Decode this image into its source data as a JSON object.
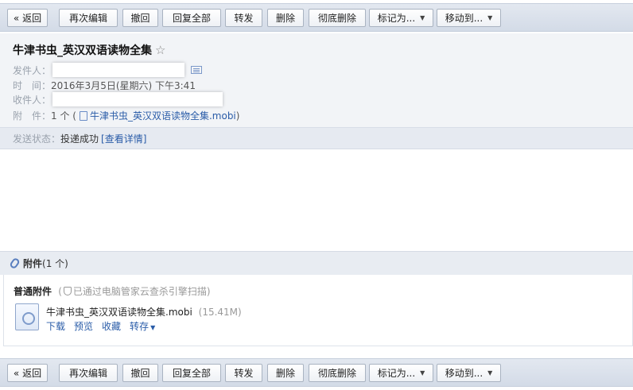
{
  "toolbar": {
    "back": "« 返回",
    "reedit": "再次编辑",
    "recall": "撤回",
    "reply_all": "回复全部",
    "forward": "转发",
    "delete": "删除",
    "delete_permanent": "彻底删除",
    "mark_as": "标记为...",
    "move_to": "移动到..."
  },
  "mail": {
    "subject": "牛津书虫_英汉双语读物全集",
    "sender_label": "发件人：",
    "time_label": "时　间：",
    "time_value": "2016年3月5日(星期六) 下午3:41",
    "recipient_label": "收件人：",
    "attachment_label": "附　件：",
    "attachment_count": "1 个 (",
    "attachment_file": "牛津书虫_英汉双语读物全集.mobi",
    "attachment_close": ")"
  },
  "status": {
    "label": "发送状态：",
    "value": "投递成功",
    "details": "[查看详情]"
  },
  "attachments": {
    "title": "附件",
    "count": "(1 个)",
    "normal_title": "普通附件",
    "scan_note_open": "(",
    "scan_note": "已通过电脑管家云查杀引擎扫描)",
    "file_name": "牛津书虫_英汉双语读物全集.mobi",
    "file_size": "(15.41M)",
    "actions": {
      "download": "下载",
      "preview": "预览",
      "favorite": "收藏",
      "save_to": "转存"
    }
  }
}
